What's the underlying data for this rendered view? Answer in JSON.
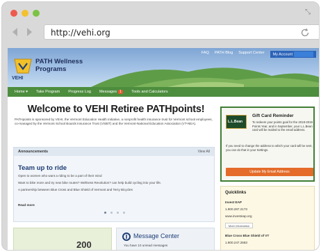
{
  "browser": {
    "url": "http://vehi.org"
  },
  "site": {
    "logo_text": "VEHI",
    "title_line1": "PATH Wellness",
    "title_line2": "Programs",
    "top_links": [
      "FAQ",
      "PATH Blog",
      "Support Center",
      "My Account"
    ],
    "nav": [
      "Home ▾",
      "Take Program",
      "Progress Log",
      "Messages",
      "Tools and Calculators"
    ],
    "messages_badge": "1"
  },
  "welcome": {
    "heading": "Welcome to VEHI Retiree PATHpoints!",
    "body": "PATHpoints is sponsored by VEHI, the Vermont Education Health Initiative, a nonprofit health insurance trust for Vermont school employees, co-managed by the Vermont School Boards Insurance Trust (VSBIT) and the Vermont-National Education Association (VT-NEA)."
  },
  "announcements": {
    "header": "Announcements",
    "view_all": "View All",
    "headline": "Team up to ride",
    "line1": "Open to women who want a riding to be a part of their mind",
    "line2": "Want to bike more and try new bike routes? Wellness Revolution? can help build cycling into your life.",
    "line3": "A partnership between Blue Cross and Blue Shield of Vermont and Terry Bicycles",
    "read_more": "Read more"
  },
  "points": {
    "value": "200"
  },
  "message_center": {
    "title": "Message Center",
    "subtitle": "You have 10 unread messages"
  },
  "gift_card": {
    "brand": "L.L.Bean",
    "title": "Gift Card Reminder",
    "body": "To redeem your points goal for the 2018-2019 Points Year, and in September, your L.L.Bean card will be mailed to the email address.",
    "body2": "If you need to change the address to which your card will be sent, you can do that in your Settings.",
    "button": "Update My Email Address"
  },
  "quicklinks": {
    "header": "Quicklinks",
    "item1": "Invest EAP",
    "phone1": "1.800.287.2173",
    "site1": "www.investeap.org",
    "more_btn": "More Information",
    "item2": "Blue Cross Blue Shield of VT",
    "phone2": "1.800.247.2583"
  },
  "colors": {
    "nav_green": "#4d8d3e",
    "header_blue": "#7fa6d4",
    "cta_orange": "#e46b2a"
  }
}
